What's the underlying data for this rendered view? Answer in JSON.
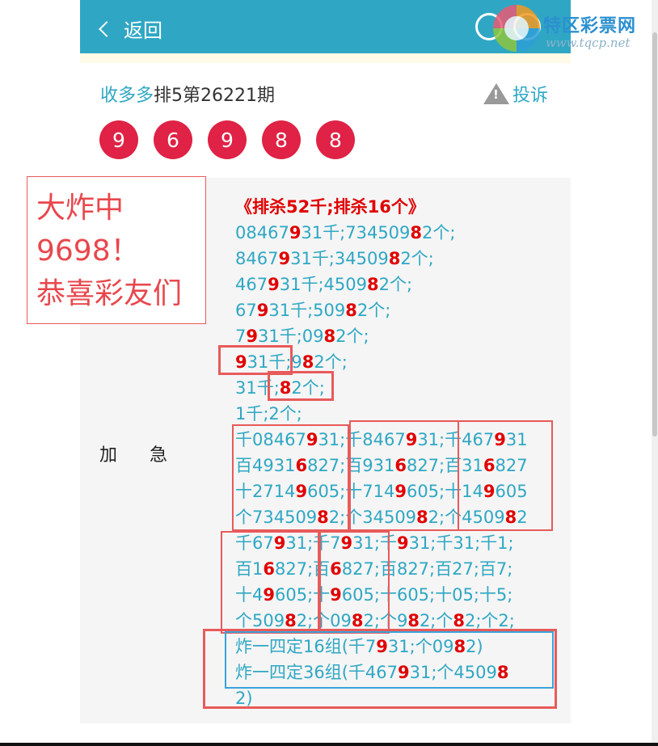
{
  "header": {
    "back_label": "返回",
    "watermark_text": "特区彩票网",
    "watermark_url": "www.tqcp.net"
  },
  "title": {
    "source": "收多多",
    "rest": "排5第26221期",
    "complain_label": "投诉"
  },
  "balls": [
    "9",
    "6",
    "9",
    "8",
    "8"
  ],
  "bubble": {
    "lines": [
      "大炸中",
      "9698！",
      "恭喜彩友们"
    ]
  },
  "field_label": "加急",
  "content": {
    "heading": "《排杀52千;排杀16个》",
    "lines": [
      [
        {
          "t": "08467"
        },
        {
          "t": "9",
          "h": 1
        },
        {
          "t": "31千;734509"
        },
        {
          "t": "8",
          "h": 1
        },
        {
          "t": "2个;"
        }
      ],
      [
        {
          "t": "8467"
        },
        {
          "t": "9",
          "h": 1
        },
        {
          "t": "31千;34509"
        },
        {
          "t": "8",
          "h": 1
        },
        {
          "t": "2个;"
        }
      ],
      [
        {
          "t": "467"
        },
        {
          "t": "9",
          "h": 1
        },
        {
          "t": "31千;4509"
        },
        {
          "t": "8",
          "h": 1
        },
        {
          "t": "2个;"
        }
      ],
      [
        {
          "t": "67"
        },
        {
          "t": "9",
          "h": 1
        },
        {
          "t": "31千;509"
        },
        {
          "t": "8",
          "h": 1
        },
        {
          "t": "2个;"
        }
      ],
      [
        {
          "t": "7"
        },
        {
          "t": "9",
          "h": 1
        },
        {
          "t": "31千;09"
        },
        {
          "t": "8",
          "h": 1
        },
        {
          "t": "2个;"
        }
      ],
      [
        {
          "t": "9",
          "h": 1
        },
        {
          "t": "31千;9"
        },
        {
          "t": "8",
          "h": 1
        },
        {
          "t": "2个;"
        }
      ],
      [
        {
          "t": "31千;"
        },
        {
          "t": "8",
          "h": 1
        },
        {
          "t": "2个;"
        }
      ],
      [
        {
          "t": "1千;2个;"
        }
      ],
      [
        {
          "t": "千08467"
        },
        {
          "t": "9",
          "h": 1
        },
        {
          "t": "31;千8467"
        },
        {
          "t": "9",
          "h": 1
        },
        {
          "t": "31;千467"
        },
        {
          "t": "9",
          "h": 1
        },
        {
          "t": "31"
        }
      ],
      [
        {
          "t": "百4931"
        },
        {
          "t": "6",
          "h": 1
        },
        {
          "t": "827;百931"
        },
        {
          "t": "6",
          "h": 1
        },
        {
          "t": "827;百31"
        },
        {
          "t": "6",
          "h": 1
        },
        {
          "t": "827"
        }
      ],
      [
        {
          "t": "十2714"
        },
        {
          "t": "9",
          "h": 1
        },
        {
          "t": "605;十714"
        },
        {
          "t": "9",
          "h": 1
        },
        {
          "t": "605;十14"
        },
        {
          "t": "9",
          "h": 1
        },
        {
          "t": "605"
        }
      ],
      [
        {
          "t": "个734509"
        },
        {
          "t": "8",
          "h": 1
        },
        {
          "t": "2;个34509"
        },
        {
          "t": "8",
          "h": 1
        },
        {
          "t": "2;个4509"
        },
        {
          "t": "8",
          "h": 1
        },
        {
          "t": "2"
        }
      ],
      [
        {
          "t": "千67"
        },
        {
          "t": "9",
          "h": 1
        },
        {
          "t": "31;千7"
        },
        {
          "t": "9",
          "h": 1
        },
        {
          "t": "31;千"
        },
        {
          "t": "9",
          "h": 1
        },
        {
          "t": "31;千31;千1;"
        }
      ],
      [
        {
          "t": "百1"
        },
        {
          "t": "6",
          "h": 1
        },
        {
          "t": "827;百"
        },
        {
          "t": "6",
          "h": 1
        },
        {
          "t": "827;百827;百27;百7;"
        }
      ],
      [
        {
          "t": "十4"
        },
        {
          "t": "9",
          "h": 1
        },
        {
          "t": "605;十"
        },
        {
          "t": "9",
          "h": 1
        },
        {
          "t": "605;十605;十05;十5;"
        }
      ],
      [
        {
          "t": "个509"
        },
        {
          "t": "8",
          "h": 1
        },
        {
          "t": "2;个09"
        },
        {
          "t": "8",
          "h": 1
        },
        {
          "t": "2;个9"
        },
        {
          "t": "8",
          "h": 1
        },
        {
          "t": "2;个"
        },
        {
          "t": "8",
          "h": 1
        },
        {
          "t": "2;个2;"
        }
      ],
      [
        {
          "t": "炸一四定16组(千7"
        },
        {
          "t": "9",
          "h": 1
        },
        {
          "t": "31;个09"
        },
        {
          "t": "8",
          "h": 1
        },
        {
          "t": "2)"
        }
      ],
      [
        {
          "t": "炸一四定36组(千467"
        },
        {
          "t": "9",
          "h": 1
        },
        {
          "t": "31;个4509"
        },
        {
          "t": "8",
          "h": 1
        }
      ],
      [
        {
          "t": "2)"
        }
      ]
    ]
  }
}
